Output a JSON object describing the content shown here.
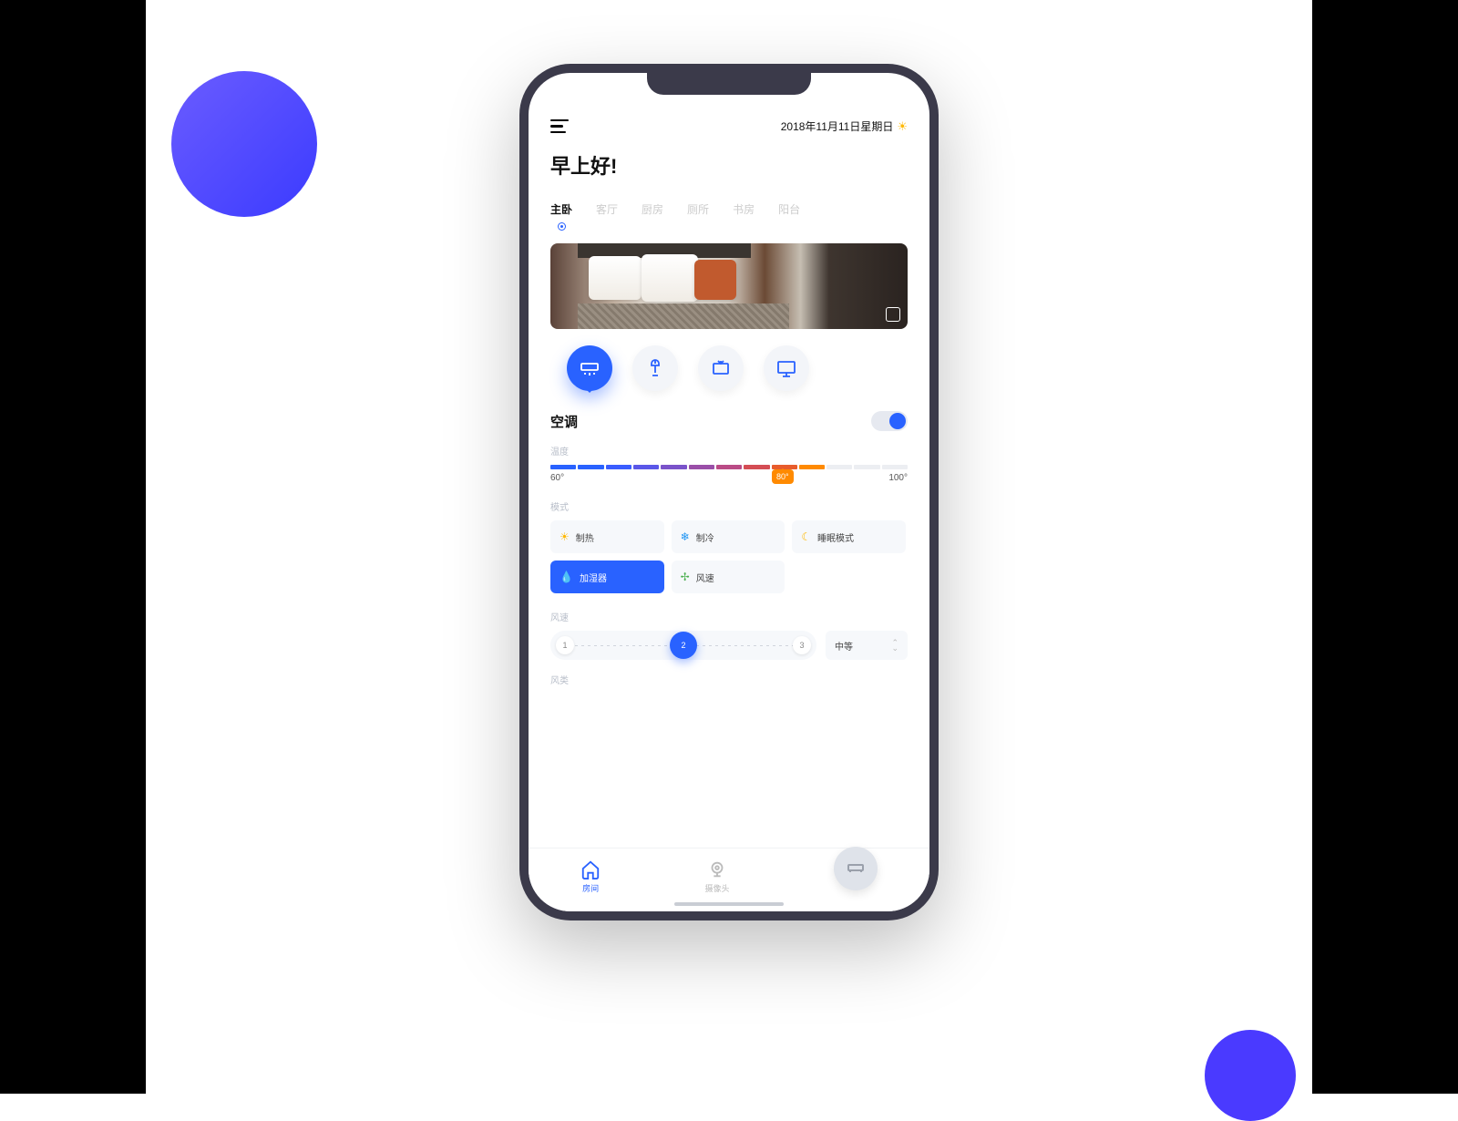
{
  "header": {
    "date": "2018年11月11日星期日"
  },
  "greeting": "早上好!",
  "tabs": [
    "主卧",
    "客厅",
    "厨房",
    "厕所",
    "书房",
    "阳台"
  ],
  "activeTab": 0,
  "devices": [
    {
      "name": "ac-icon",
      "active": true
    },
    {
      "name": "lamp-icon",
      "active": false
    },
    {
      "name": "tv-icon",
      "active": false
    },
    {
      "name": "monitor-icon",
      "active": false
    }
  ],
  "section": {
    "title": "空调",
    "toggle": true
  },
  "temperature": {
    "label": "温度",
    "min": "60°",
    "max": "100°",
    "value": "80°",
    "segments": [
      "#2962ff",
      "#2962ff",
      "#3a5dff",
      "#5a57e8",
      "#7a53ca",
      "#9a4fa8",
      "#ba4b86",
      "#d44d54",
      "#e85c2c",
      "#ff8a00",
      "#eceef2",
      "#eceef2",
      "#eceef2"
    ]
  },
  "mode": {
    "label": "模式",
    "items": [
      {
        "icon": "☀",
        "color": "#ffb800",
        "text": "制热",
        "active": false
      },
      {
        "icon": "❄",
        "color": "#2196f3",
        "text": "制冷",
        "active": false
      },
      {
        "icon": "☾",
        "color": "#ffb800",
        "text": "睡眠模式",
        "active": false
      },
      {
        "icon": "💧",
        "color": "#fff",
        "text": "加湿器",
        "active": true
      },
      {
        "icon": "✢",
        "color": "#4caf50",
        "text": "风速",
        "active": false
      }
    ]
  },
  "fan": {
    "label": "风速",
    "nodes": [
      "1",
      "2",
      "3"
    ],
    "active": 1,
    "select": "中等"
  },
  "fanType": {
    "label": "风类"
  },
  "nav": {
    "items": [
      {
        "name": "home-icon",
        "label": "房间",
        "active": true
      },
      {
        "name": "camera-icon",
        "label": "摄像头",
        "active": false
      }
    ]
  }
}
